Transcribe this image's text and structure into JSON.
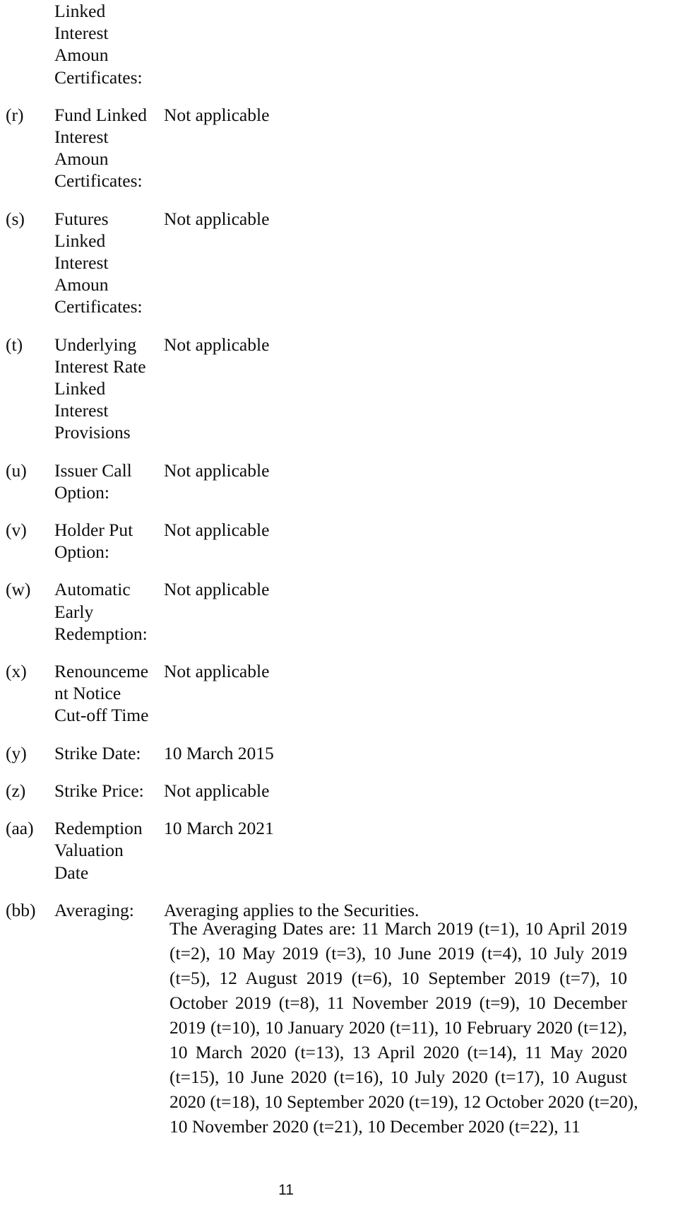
{
  "document": {
    "page_number": "11",
    "not_applicable": "Not applicable"
  },
  "terms": [
    {
      "letter": "",
      "term_lines": [
        "Linked",
        "Interest",
        "Amoun",
        "Certificates:"
      ],
      "value": ""
    },
    {
      "letter": "(r)",
      "term_lines": [
        "Fund Linked",
        "Interest",
        "Amoun",
        "Certificates:"
      ],
      "value": "Not applicable"
    },
    {
      "letter": "(s)",
      "term_lines": [
        "Futures",
        "Linked",
        "Interest",
        "Amoun",
        "Certificates:"
      ],
      "value": "Not applicable"
    },
    {
      "letter": "(t)",
      "term_lines": [
        "Underlying",
        "Interest Rate",
        "Linked",
        "Interest",
        "Provisions"
      ],
      "value": "Not applicable"
    },
    {
      "letter": "(u)",
      "term_lines": [
        "Issuer Call",
        "Option:"
      ],
      "value": "Not applicable"
    },
    {
      "letter": "(v)",
      "term_lines": [
        "Holder Put",
        "Option:"
      ],
      "value": "Not applicable"
    },
    {
      "letter": "(w)",
      "term_lines": [
        "Automatic",
        "Early",
        "Redemption:"
      ],
      "value": "Not applicable"
    },
    {
      "letter": "(x)",
      "term_lines": [
        "Renounceme",
        "nt Notice",
        "Cut-off Time"
      ],
      "value": "Not applicable"
    },
    {
      "letter": "(y)",
      "term_lines": [
        "Strike Date:"
      ],
      "value": "10 March 2015"
    },
    {
      "letter": "(z)",
      "term_lines": [
        "Strike Price:"
      ],
      "value": "Not applicable"
    },
    {
      "letter": "(aa)",
      "term_lines": [
        "Redemption",
        "Valuation",
        "Date"
      ],
      "value": "10 March 2021"
    },
    {
      "letter": "(bb)",
      "term_lines": [
        "Averaging:"
      ],
      "value": "Averaging applies to the Securities."
    }
  ],
  "averaging": {
    "lines": [
      "The Averaging Dates are: 11 March 2019 (t=1), 10 April 2019",
      "(t=2), 10 May 2019 (t=3), 10 June 2019 (t=4), 10 July 2019",
      "(t=5), 12 August 2019 (t=6), 10 September 2019 (t=7), 10",
      "October 2019 (t=8), 11 November 2019 (t=9), 10 December",
      "2019 (t=10), 10 January 2020 (t=11), 10 February 2020 (t=12),",
      "10 March 2020 (t=13), 13 April 2020 (t=14), 11 May 2020",
      "(t=15), 10 June 2020 (t=16), 10 July 2020 (t=17), 10 August",
      "2020 (t=18), 10 September 2020 (t=19), 12 October 2020 (t=20),",
      "10 November 2020 (t=21), 10 December 2020 (t=22), 11"
    ]
  }
}
